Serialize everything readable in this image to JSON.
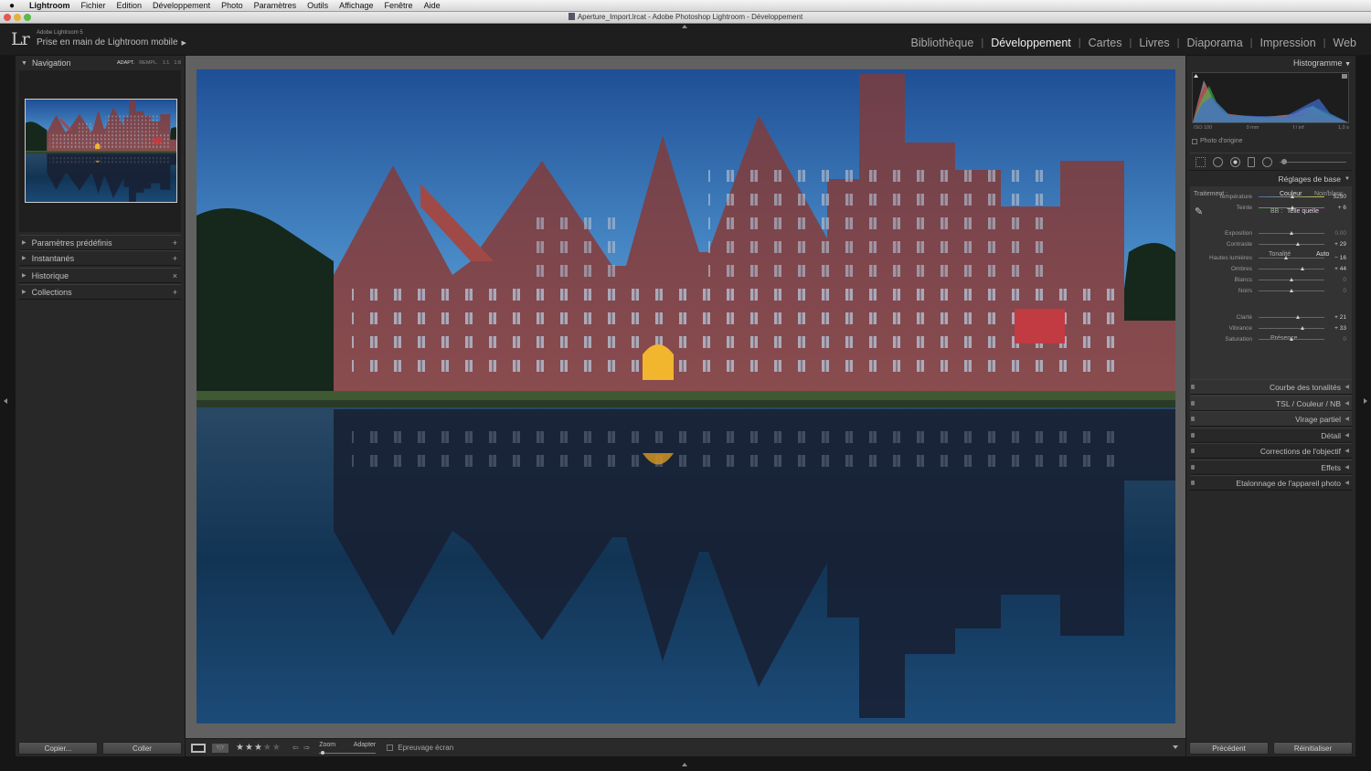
{
  "menubar": {
    "app": "Lightroom",
    "items": [
      "Fichier",
      "Edition",
      "Développement",
      "Photo",
      "Paramètres",
      "Outils",
      "Affichage",
      "Fenêtre",
      "Aide"
    ]
  },
  "window": {
    "title": "Aperture_Import.lrcat - Adobe Photoshop Lightroom - Développement"
  },
  "identity": {
    "logo": "Lr",
    "subtitle": "Adobe Lightroom 5",
    "main": "Prise en main de Lightroom mobile",
    "arrow": "▶"
  },
  "modules": [
    {
      "label": "Bibliothèque",
      "active": false
    },
    {
      "label": "Développement",
      "active": true
    },
    {
      "label": "Cartes",
      "active": false
    },
    {
      "label": "Livres",
      "active": false
    },
    {
      "label": "Diaporama",
      "active": false
    },
    {
      "label": "Impression",
      "active": false
    },
    {
      "label": "Web",
      "active": false
    }
  ],
  "left_panel": {
    "navigator": {
      "title": "Navigation",
      "options": [
        "ADAPT.",
        "REMPL.",
        "1:1",
        "1:8"
      ]
    },
    "sections": [
      {
        "label": "Paramètres prédéfinis",
        "action": "+"
      },
      {
        "label": "Instantanés",
        "action": "+"
      },
      {
        "label": "Historique",
        "action": "×"
      },
      {
        "label": "Collections",
        "action": "+"
      }
    ],
    "buttons": {
      "copy": "Copier...",
      "paste": "Coller"
    }
  },
  "toolbar": {
    "zoom_label": "Zoom",
    "fit_label": "Adapter",
    "softproof": "Epreuvage écran",
    "stars": 3,
    "stars_total": 5,
    "view_mode": "Y|Y"
  },
  "right_panel": {
    "histogram": {
      "title": "Histogramme",
      "iso": "ISO 100",
      "focal": "0 mm",
      "aperture": "f / inf",
      "shutter": "1,0 s",
      "original": "Photo d'origine"
    },
    "basic": {
      "title": "Réglages de base",
      "treatment_label": "Traitement :",
      "treatment_color": "Couleur",
      "treatment_bw": "Noir/blanc",
      "wb_label": "BB :",
      "wb_value": "Telle quelle",
      "tone_label": "Tonalité",
      "auto_label": "Auto",
      "presence_label": "Présence",
      "sliders": [
        {
          "key": "temp",
          "label": "Température",
          "value": "5250",
          "pos": 0.52
        },
        {
          "key": "tint",
          "label": "Teinte",
          "value": "+ 6",
          "pos": 0.52
        },
        {
          "key": "exposure",
          "label": "Exposition",
          "value": "0,00",
          "pos": 0.5
        },
        {
          "key": "contrast",
          "label": "Contraste",
          "value": "+ 29",
          "pos": 0.6
        },
        {
          "key": "highlights",
          "label": "Hautes lumières",
          "value": "− 16",
          "pos": 0.42
        },
        {
          "key": "shadows",
          "label": "Ombres",
          "value": "+ 44",
          "pos": 0.68
        },
        {
          "key": "whites",
          "label": "Blancs",
          "value": "0",
          "pos": 0.5
        },
        {
          "key": "blacks",
          "label": "Noirs",
          "value": "0",
          "pos": 0.5
        },
        {
          "key": "clarity",
          "label": "Clarté",
          "value": "+ 21",
          "pos": 0.6
        },
        {
          "key": "vibrance",
          "label": "Vibrance",
          "value": "+ 33",
          "pos": 0.67
        },
        {
          "key": "saturation",
          "label": "Saturation",
          "value": "0",
          "pos": 0.5
        }
      ]
    },
    "sections": [
      {
        "label": "Courbe des tonalités"
      },
      {
        "label": "TSL / Couleur / NB"
      },
      {
        "label": "Virage partiel"
      },
      {
        "label": "Détail"
      },
      {
        "label": "Corrections de l'objectif"
      },
      {
        "label": "Effets"
      },
      {
        "label": "Etalonnage de l'appareil photo"
      }
    ],
    "buttons": {
      "previous": "Précédent",
      "reset": "Réinitialiser"
    }
  }
}
